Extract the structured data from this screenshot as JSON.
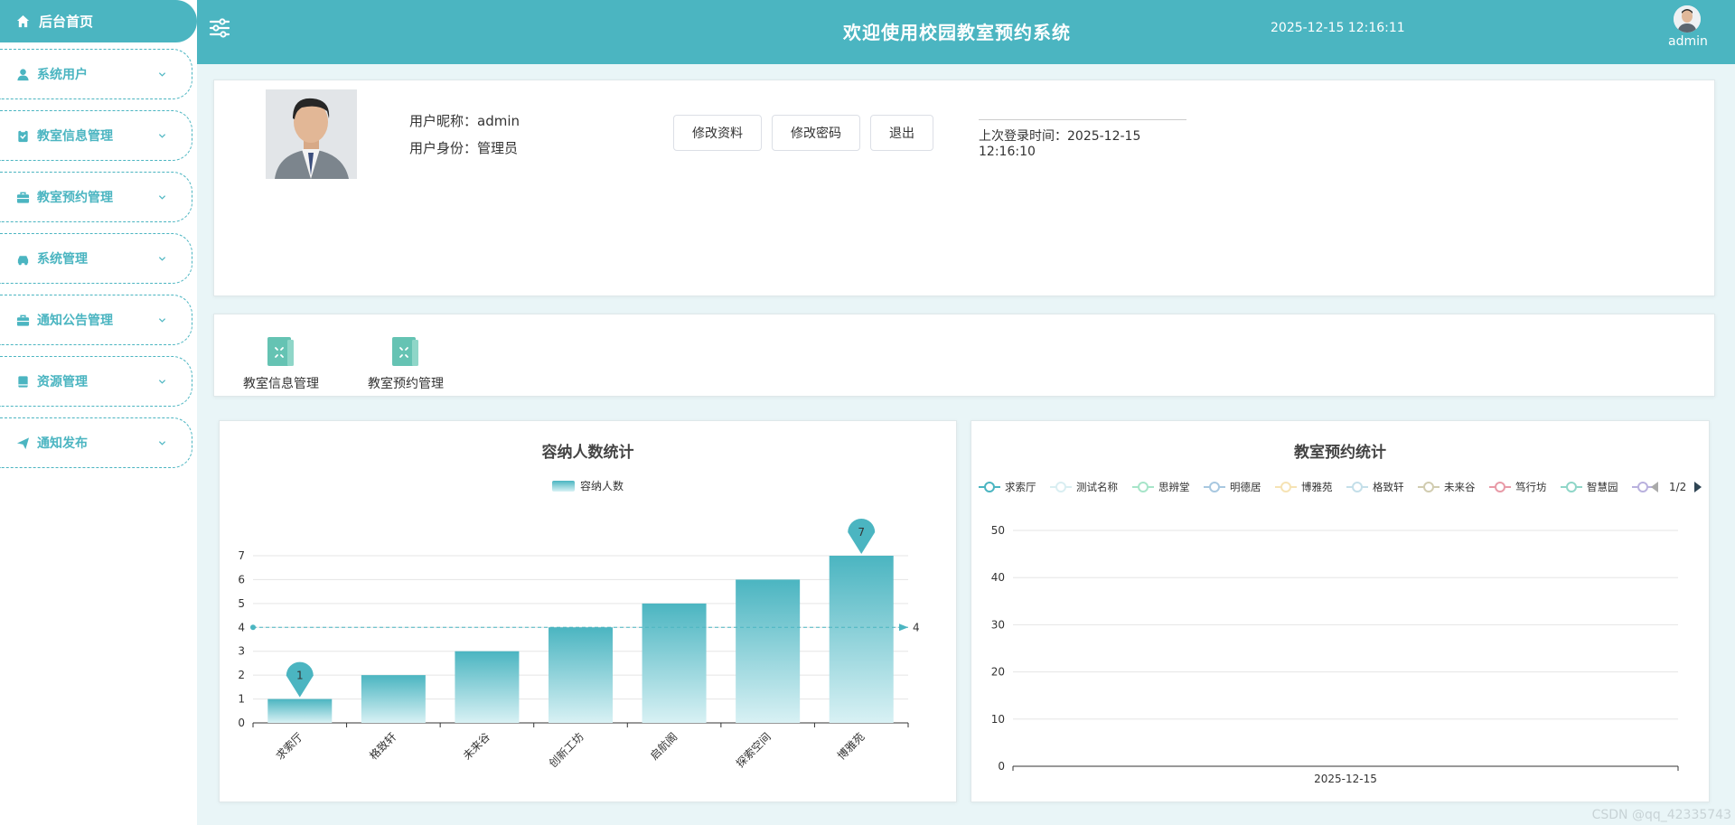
{
  "sidebar": {
    "home_label": "后台首页",
    "items": [
      {
        "label": "系统用户",
        "icon": "user-icon"
      },
      {
        "label": "教室信息管理",
        "icon": "clipboard-icon"
      },
      {
        "label": "教室预约管理",
        "icon": "briefcase-icon"
      },
      {
        "label": "系统管理",
        "icon": "car-icon"
      },
      {
        "label": "通知公告管理",
        "icon": "briefcase-icon"
      },
      {
        "label": "资源管理",
        "icon": "book-icon"
      },
      {
        "label": "通知发布",
        "icon": "send-icon"
      }
    ]
  },
  "header": {
    "title": "欢迎使用校园教室预约系统",
    "datetime": "2025-12-15 12:16:11",
    "username": "admin"
  },
  "profile": {
    "nickname_line": "用户昵称：admin",
    "role_line": "用户身份：管理员",
    "buttons": [
      "修改资料",
      "修改密码",
      "退出"
    ],
    "last_login": "上次登录时间：2025-12-15 12:16:10"
  },
  "shortcuts": [
    {
      "label": "教室信息管理"
    },
    {
      "label": "教室预约管理"
    }
  ],
  "charts": {
    "capacity_title": "容纳人数统计",
    "reservation_title": "教室预约统计"
  },
  "chart_data": [
    {
      "type": "bar",
      "title": "容纳人数统计",
      "legend": [
        "容纳人数"
      ],
      "categories": [
        "求索厅",
        "格致轩",
        "未来谷",
        "创新工坊",
        "启航阁",
        "探索空间",
        "博雅苑"
      ],
      "values": [
        1,
        2,
        3,
        4,
        5,
        6,
        7
      ],
      "ylim": [
        0,
        7
      ],
      "yticks": [
        0,
        1,
        2,
        3,
        4,
        5,
        6,
        7
      ],
      "mark_points": [
        {
          "label": "1",
          "category": "求索厅"
        },
        {
          "label": "7",
          "category": "博雅苑"
        }
      ],
      "mark_line": {
        "value": 4,
        "label": "4"
      },
      "grid": true,
      "legend_position": "top-center",
      "colors": {
        "bar_top": "#4bb5c1",
        "bar_bottom": "#d5f0f3",
        "marker": "#4bb5c1"
      }
    },
    {
      "type": "line",
      "title": "教室预约统计",
      "legend": [
        "求索厅",
        "测试名称",
        "思辨堂",
        "明德居",
        "博雅苑",
        "格致轩",
        "未来谷",
        "笃行坊",
        "智慧园"
      ],
      "legend_page": "1/2",
      "legend_colors": [
        "#4bb5c1",
        "#d9eef2",
        "#a7e5c9",
        "#a8c8e0",
        "#f6e3b4",
        "#c4dfe9",
        "#d1ccb0",
        "#e89aa7",
        "#8fd6c8",
        "#b9b1de"
      ],
      "categories": [
        "2025-12-15"
      ],
      "ylim": [
        0,
        50
      ],
      "yticks": [
        0,
        10,
        20,
        30,
        40,
        50
      ],
      "grid": true,
      "legend_position": "top"
    }
  ],
  "watermark": "CSDN @qq_42335743",
  "colors": {
    "primary": "#4bb5c1",
    "background": "#e9f5f7"
  }
}
